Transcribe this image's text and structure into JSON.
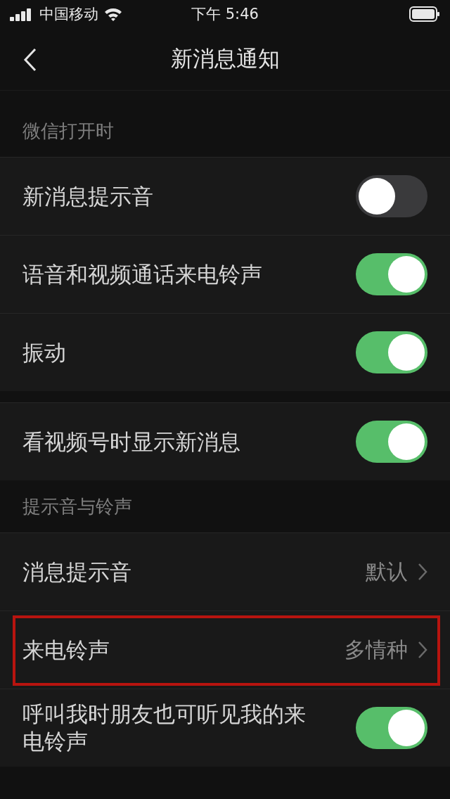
{
  "status_bar": {
    "carrier": "中国移动",
    "time": "下午 5:46"
  },
  "nav": {
    "title": "新消息通知"
  },
  "sections": [
    {
      "header": "微信打开时",
      "rows": [
        {
          "kind": "toggle",
          "label": "新消息提示音",
          "on": false
        },
        {
          "kind": "toggle",
          "label": "语音和视频通话来电铃声",
          "on": true
        },
        {
          "kind": "toggle",
          "label": "振动",
          "on": true
        }
      ]
    },
    {
      "rows": [
        {
          "kind": "toggle",
          "label": "看视频号时显示新消息",
          "on": true
        }
      ]
    },
    {
      "header": "提示音与铃声",
      "rows": [
        {
          "kind": "link",
          "label": "消息提示音",
          "value": "默认",
          "highlighted": false
        },
        {
          "kind": "link",
          "label": "来电铃声",
          "value": "多情种",
          "highlighted": true
        },
        {
          "kind": "toggle",
          "label": "呼叫我时朋友也可听见我的来电铃声",
          "on": true
        }
      ]
    }
  ]
}
